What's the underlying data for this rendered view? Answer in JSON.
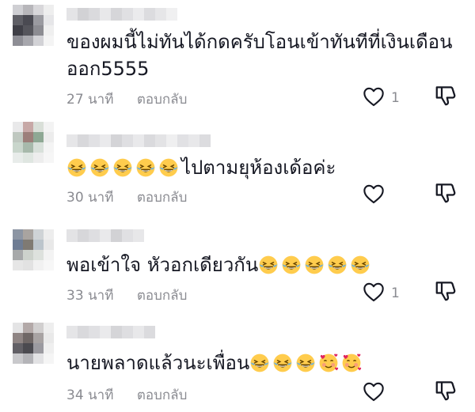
{
  "comments": [
    {
      "text_lines": [
        "ของผมนี้ไม่ทันได้กดครับโอนเข้าทันทีที่เงินเดือน",
        "ออก5555"
      ],
      "emojis": [],
      "time": "27 นาที",
      "reply_label": "ตอบกลับ",
      "like_count": "1",
      "like_icon": "heart-outline",
      "dislike_icon": "thumbs-down-outline",
      "avatar_colors": [
        "#cfcfd3",
        "#b7b6ba",
        "#d8d7da",
        "#eeeeee",
        "#5f5f66",
        "#4a4a52",
        "#9a9aa0",
        "#e6e6e8",
        "#3f3f47",
        "#55555c",
        "#8c8c92",
        "#efefef",
        "#8e8e95",
        "#a7a7ad",
        "#d2d2d6",
        "#f4f4f4"
      ],
      "name_colors": [
        "#e4e4e6",
        "#d2d2d5",
        "#dadadd",
        "#e8e8ea",
        "#d6d6d9",
        "#e0e0e3",
        "#ebebed",
        "#dcdcdf",
        "#e6e6e8",
        "#f0f0f1"
      ]
    },
    {
      "text_lines": [
        "ไปตามยุห้องเด้อค่ะ"
      ],
      "emojis": [
        "😂",
        "😂",
        "😂",
        "😂",
        "😂"
      ],
      "time": "30 นาที",
      "reply_label": "ตอบกลับ",
      "like_count": "",
      "like_icon": "heart-outline",
      "dislike_icon": "thumbs-down-outline",
      "avatar_colors": [
        "#e9e9ea",
        "#c7a8a6",
        "#d9dfd8",
        "#f3f3f3",
        "#bfc8c0",
        "#9c7f7a",
        "#8ea894",
        "#ececec",
        "#c9d6cc",
        "#a7b9ab",
        "#d8e0da",
        "#f4f4f4",
        "#e8ecea",
        "#dfe6e1",
        "#ededed",
        "#f6f6f6"
      ],
      "name_colors": [
        "#e6e6e8",
        "#d8d8db",
        "#e1e1e4",
        "#eaeaec",
        "#d4d4d7",
        "#dfdfe2",
        "#e9e9eb",
        "#dadadd",
        "#e3e3e5",
        "#efeff0",
        "#e1e1e4",
        "#e8e8ea",
        "#dcdcdf"
      ]
    },
    {
      "text_lines": [
        "พอเข้าใจ หัวอกเดียวกัน"
      ],
      "emojis": [
        "😂",
        "😂",
        "😂",
        "😂",
        "😂"
      ],
      "time": "33 นาที",
      "reply_label": "ตอบกลับ",
      "like_count": "1",
      "like_icon": "heart-outline",
      "dislike_icon": "thumbs-down-outline",
      "avatar_colors": [
        "#8c95a3",
        "#a9a4a0",
        "#cfd3d6",
        "#ededed",
        "#6e7c93",
        "#7f7a73",
        "#bcc5cc",
        "#e8e8e8",
        "#a7a9aa",
        "#cdd2cc",
        "#dde1dd",
        "#f3f3f3",
        "#e6e6e6",
        "#e2e2e2",
        "#f1f1f1",
        "#f7f7f7"
      ],
      "name_colors": [
        "#e3e3e5",
        "#d7d7da",
        "#dedee1",
        "#e9e9eb",
        "#d2d2d5",
        "#e0e0e3",
        "#e7e7e9"
      ]
    },
    {
      "text_lines": [
        "นายพลาดแล้วนะเพื่อน"
      ],
      "emojis": [
        "😂",
        "😂",
        "😂",
        "🥰",
        "🥰"
      ],
      "time": "34 นาที",
      "reply_label": "ตอบกลับ",
      "like_count": "",
      "like_icon": "heart-outline",
      "dislike_icon": "thumbs-down-outline",
      "avatar_colors": [
        "#e4e4e5",
        "#b3a9a8",
        "#d1cfcf",
        "#eeeeee",
        "#8f8584",
        "#6f6766",
        "#a8a3a3",
        "#e9e9e9",
        "#626066",
        "#4b4a50",
        "#9b9aa0",
        "#efefef",
        "#c9c9cc",
        "#b4b4b8",
        "#e2e2e4",
        "#f5f5f5"
      ],
      "name_colors": [
        "#e5e5e7",
        "#d9d9dc",
        "#e0e0e3",
        "#eaeaec",
        "#d5d5d8",
        "#dedee1",
        "#e8e8ea",
        "#dbdbde"
      ]
    }
  ]
}
